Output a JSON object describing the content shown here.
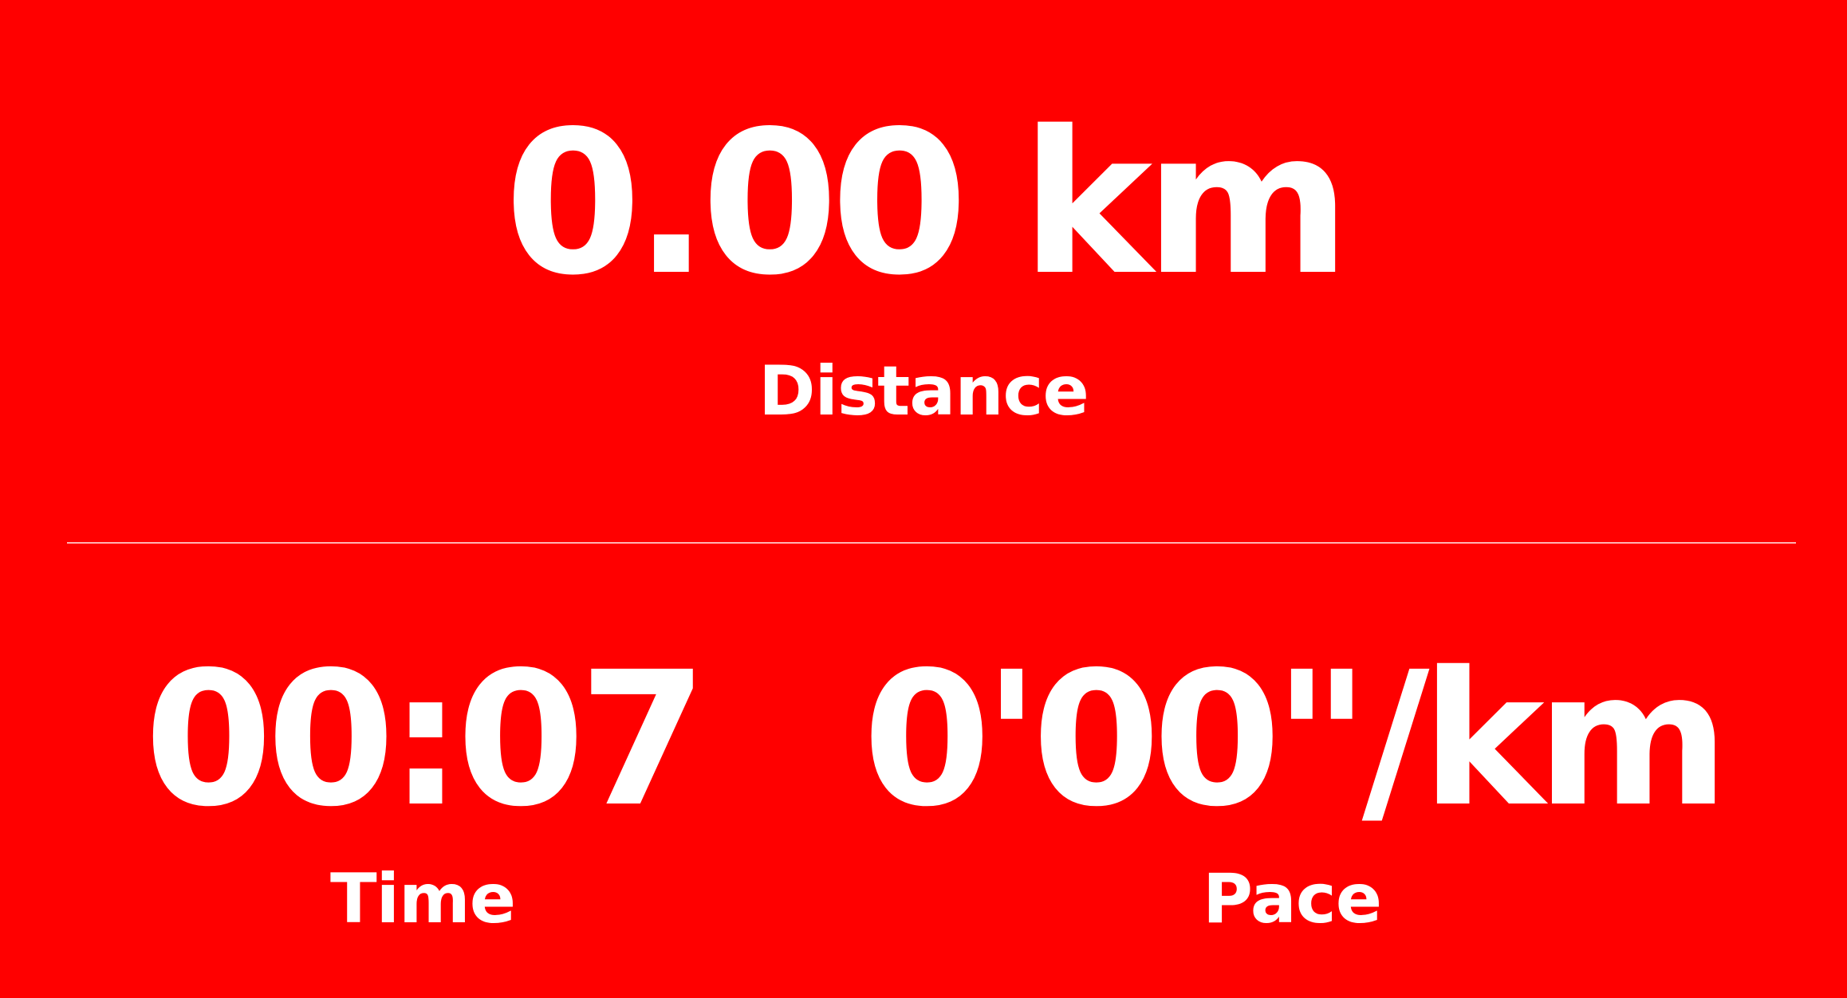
{
  "theme": {
    "background": "#ff0000",
    "text": "#ffffff"
  },
  "distance": {
    "value": "0.00 km",
    "label": "Distance"
  },
  "time": {
    "value": "00:07",
    "label": "Time"
  },
  "pace": {
    "value": "0'00\"/km",
    "label": "Pace"
  }
}
